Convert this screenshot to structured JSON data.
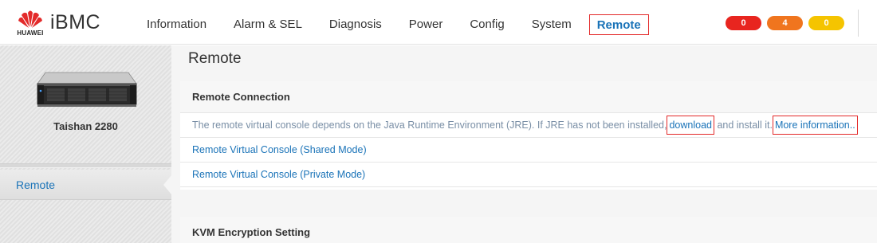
{
  "brand": {
    "logo_text": "HUAWEI",
    "title": "iBMC"
  },
  "nav": {
    "items": [
      "Information",
      "Alarm & SEL",
      "Diagnosis",
      "Power",
      "Config",
      "System",
      "Remote"
    ],
    "active": "Remote"
  },
  "alarms": {
    "critical": "0",
    "major": "4",
    "minor": "0"
  },
  "colors": {
    "accent": "#1a73b8",
    "critical": "#e8251f",
    "major": "#f0751e",
    "minor": "#f5c400",
    "highlight_box": "#e32a2a"
  },
  "sidebar": {
    "server_name": "Taishan 2280",
    "item": "Remote"
  },
  "main": {
    "title": "Remote",
    "connection": {
      "header": "Remote Connection",
      "info_text": "The remote virtual console depends on the Java Runtime Environment (JRE). If JRE has not been installed,",
      "download_link": "download",
      "info_mid": " and install it.",
      "more_link": "More information..",
      "shared_link": "Remote Virtual Console (Shared Mode)",
      "private_link": "Remote Virtual Console (Private Mode)"
    },
    "kvm": {
      "header": "KVM Encryption Setting"
    }
  }
}
